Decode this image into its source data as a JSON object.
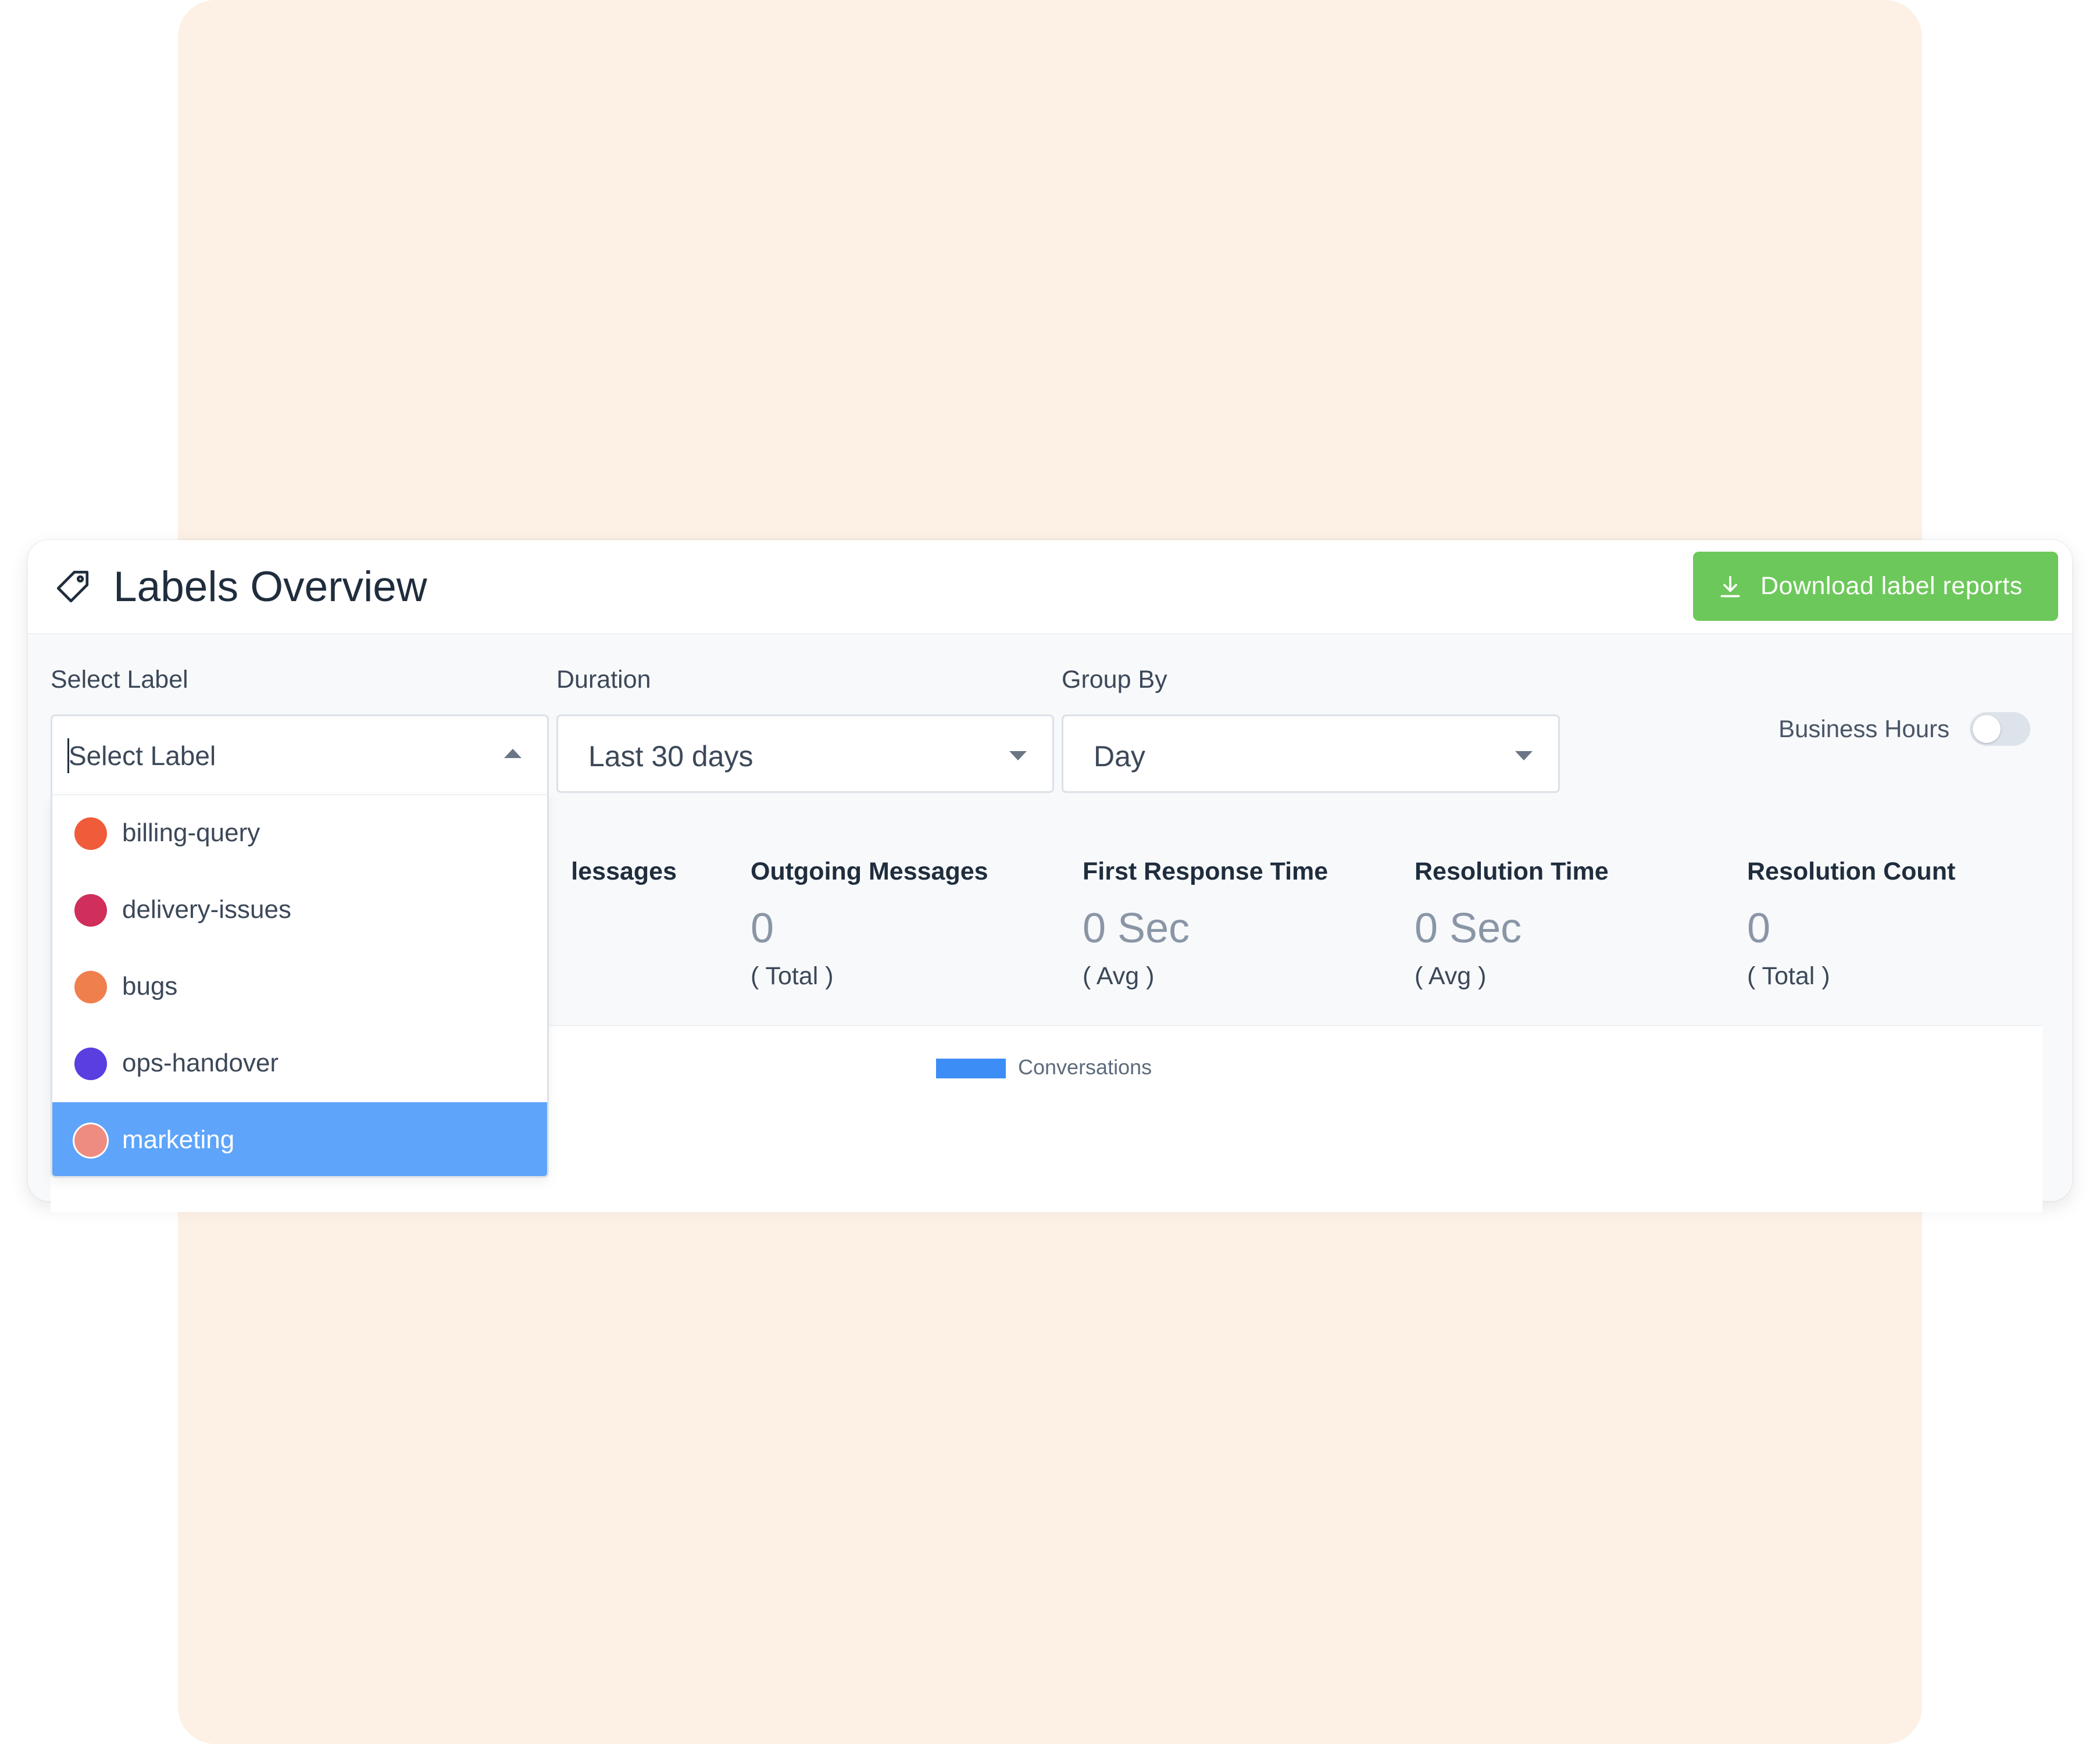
{
  "header": {
    "title": "Labels Overview",
    "download_label": "Download label reports"
  },
  "filters": {
    "label": {
      "title": "Select Label",
      "placeholder": "Select Label",
      "options": [
        {
          "label": "billing-query",
          "color": "#f05b3a"
        },
        {
          "label": "delivery-issues",
          "color": "#cf2f5a"
        },
        {
          "label": "bugs",
          "color": "#f07f4e"
        },
        {
          "label": "ops-handover",
          "color": "#5a3ee0"
        },
        {
          "label": "marketing",
          "color": "#ee8c82",
          "selected": true
        }
      ]
    },
    "duration": {
      "title": "Duration",
      "value": "Last 30 days"
    },
    "group_by": {
      "title": "Group By",
      "value": "Day"
    },
    "business_hours": {
      "label": "Business Hours",
      "enabled": false
    }
  },
  "metrics": {
    "incoming_partial": "lessages",
    "outgoing": {
      "title": "Outgoing Messages",
      "value": "0",
      "unit": "( Total )"
    },
    "first_response": {
      "title": "First Response Time",
      "value": "0 Sec",
      "unit": "( Avg )"
    },
    "resolution_time": {
      "title": "Resolution Time",
      "value": "0 Sec",
      "unit": "( Avg )"
    },
    "resolution_count": {
      "title": "Resolution Count",
      "value": "0",
      "unit": "( Total )"
    }
  },
  "chart": {
    "legend": "Conversations",
    "legend_color": "#3c8df6"
  },
  "colors": {
    "accent_green": "#6cc85a",
    "selected_blue": "#5ea4fa",
    "background_peach": "#fdf0e5"
  }
}
